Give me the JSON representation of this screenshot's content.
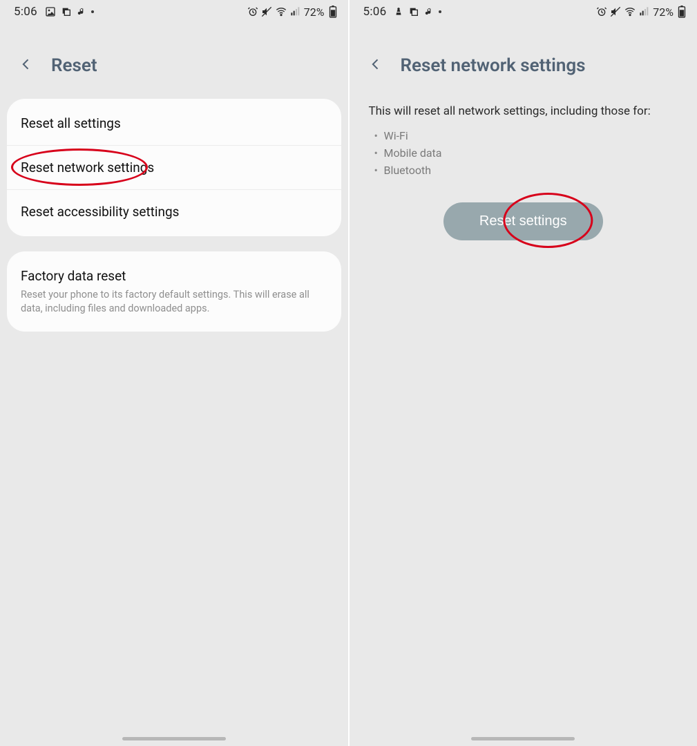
{
  "status": {
    "time": "5:06",
    "battery_percent": "72%"
  },
  "left": {
    "title": "Reset",
    "items": [
      {
        "label": "Reset all settings"
      },
      {
        "label": "Reset network settings",
        "highlight": true
      },
      {
        "label": "Reset accessibility settings"
      }
    ],
    "factory": {
      "label": "Factory data reset",
      "sub": "Reset your phone to its factory default settings. This will erase all data, including files and downloaded apps."
    }
  },
  "right": {
    "title": "Reset network settings",
    "description": "This will reset all network settings, including those for:",
    "bullets": [
      "Wi-Fi",
      "Mobile data",
      "Bluetooth"
    ],
    "button": "Reset settings",
    "button_highlight": true
  }
}
